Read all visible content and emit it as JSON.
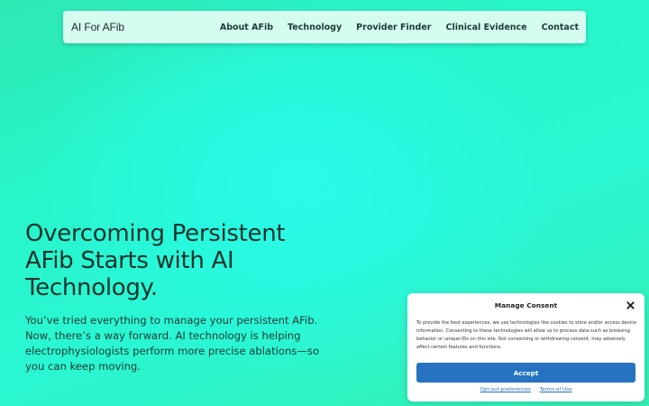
{
  "header": {
    "brand": "AI For AFib",
    "nav": [
      {
        "label": "About AFib"
      },
      {
        "label": "Technology"
      },
      {
        "label": "Provider Finder"
      },
      {
        "label": "Clinical Evidence"
      },
      {
        "label": "Contact"
      }
    ]
  },
  "hero": {
    "title": "Overcoming Persistent AFib Starts with AI Technology.",
    "body": "You’ve tried everything to manage your persistent AFib. Now, there’s a way forward. AI technology is helping electrophysiologists perform more precise ablations—so you can keep moving."
  },
  "consent": {
    "title": "Manage Consent",
    "close_icon": "close-icon",
    "text": "To provide the best experiences, we use technologies like cookies to store and/or access device information. Consenting to these technologies will allow us to process data such as browsing behavior or unique IDs on this site. Not consenting or withdrawing consent, may adversely affect certain features and functions.",
    "accept_label": "Accept",
    "opt_out_label": "Opt-out preferences",
    "terms_label": "Terms of Use"
  },
  "colors": {
    "background": "#2af6d2",
    "navbar": "#d6fbef",
    "accent": "#2573c1"
  }
}
